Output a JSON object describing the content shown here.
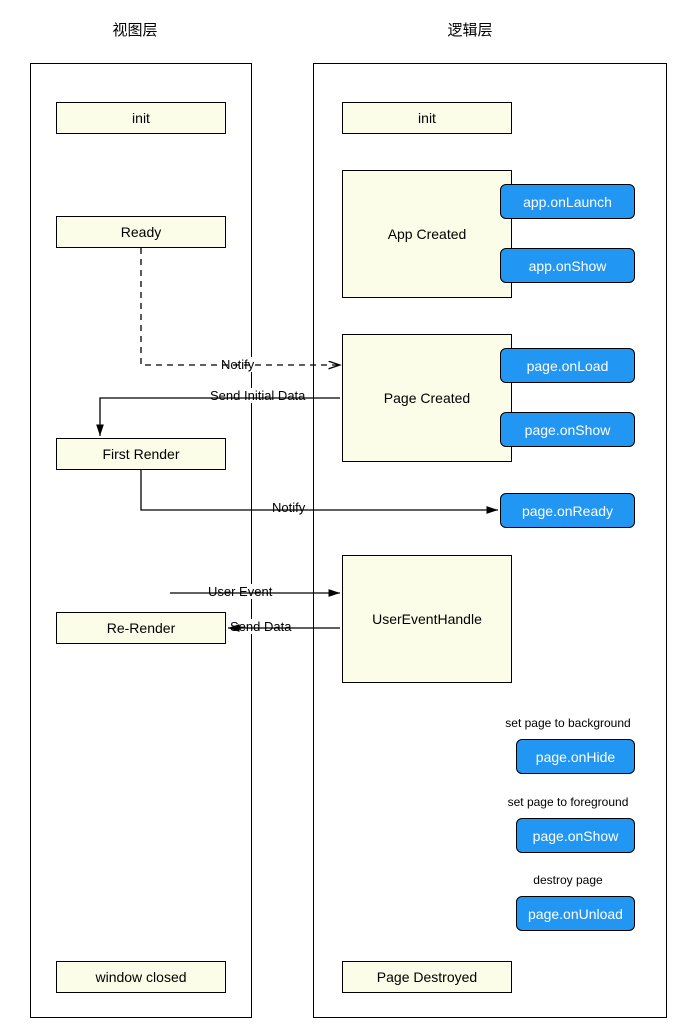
{
  "headings": {
    "view_layer": "视图层",
    "logic_layer": "逻辑层"
  },
  "view": {
    "init": "init",
    "ready": "Ready",
    "first_render": "First Render",
    "re_render": "Re-Render",
    "window_closed": "window closed"
  },
  "logic": {
    "init": "init",
    "app_created": "App Created",
    "page_created": "Page Created",
    "user_event_handle": "UserEventHandle",
    "page_destroyed": "Page Destroyed"
  },
  "events": {
    "app_onlaunch": "app.onLaunch",
    "app_onshow": "app.onShow",
    "page_onload": "page.onLoad",
    "page_onshow": "page.onShow",
    "page_onready": "page.onReady",
    "page_onhide": "page.onHide",
    "page_onshow2": "page.onShow",
    "page_onunload": "page.onUnload"
  },
  "captions": {
    "set_background": "set page to background",
    "set_foreground": "set page to foreground",
    "destroy_page": "destroy page"
  },
  "edge_labels": {
    "notify1": "Notify",
    "send_initial": "Send Initial Data",
    "notify2": "Notify",
    "user_event": "User Event",
    "send_data": "Send Data"
  }
}
